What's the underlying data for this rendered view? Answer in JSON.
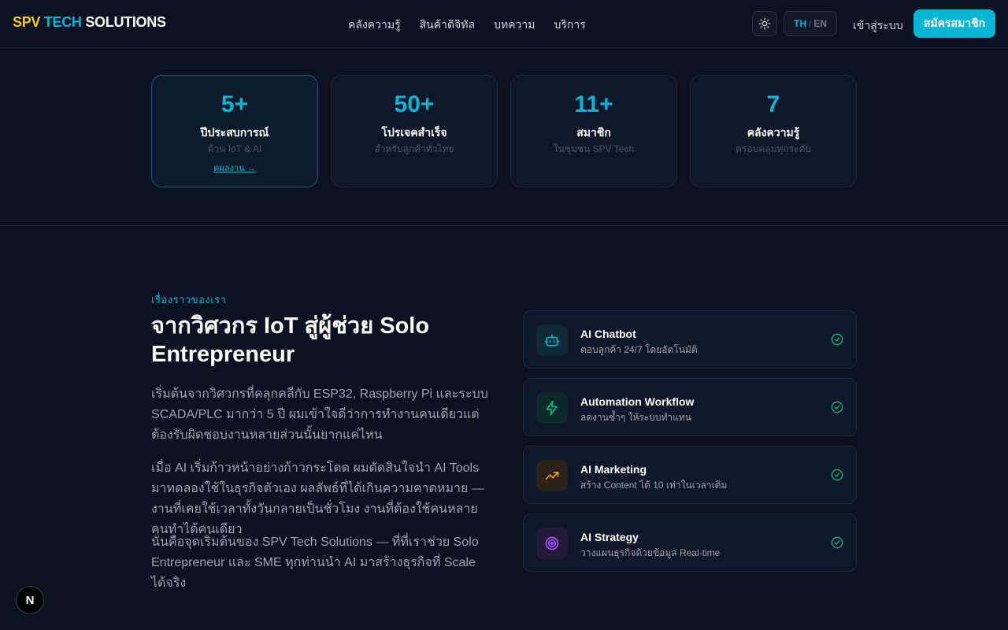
{
  "brand": {
    "part1": "SPV",
    "part2": "TECH",
    "part3": "SOLUTIONS"
  },
  "nav": [
    "คลังความรู้",
    "สินค้าดิจิทัล",
    "บทความ",
    "บริการ"
  ],
  "header": {
    "lang_th": "TH",
    "lang_sep": "/",
    "lang_en": "EN",
    "login": "เข้าสู่ระบบ",
    "signup": "สมัครสมาชิก",
    "theme_icon": "sun-icon"
  },
  "stats": [
    {
      "num": "5+",
      "label": "ปีประสบการณ์",
      "sub": "ด้าน IoT & AI",
      "link": "ดูผลงาน →"
    },
    {
      "num": "50+",
      "label": "โปรเจคสำเร็จ",
      "sub": "สำหรับลูกค้าทั่วไทย"
    },
    {
      "num": "11+",
      "label": "สมาชิก",
      "sub": "ในชุมชน SPV Tech"
    },
    {
      "num": "7",
      "label": "คลังความรู้",
      "sub": "ครอบคลุมทุกระดับ"
    }
  ],
  "story": {
    "eyebrow": "เรื่องราวของเรา",
    "title": "จากวิศวกร IoT สู่ผู้ช่วย Solo Entrepreneur",
    "p1": "เริ่มต้นจากวิศวกรที่คลุกคลีกับ ESP32, Raspberry Pi และระบบ SCADA/PLC มากว่า 5 ปี ผมเข้าใจดีว่าการทำงานคนเดียวแต่ต้องรับผิดชอบงานหลายส่วนนั้นยากแค่ไหน",
    "p2": "เมื่อ AI เริ่มก้าวหน้าอย่างก้าวกระโดด ผมตัดสินใจนำ AI Tools มาทดลองใช้ในธุรกิจตัวเอง ผลลัพธ์ที่ได้เกินความคาดหมาย — งานที่เคยใช้เวลาทั้งวันกลายเป็นชั่วโมง งานที่ต้องใช้คนหลายคนทำได้คนเดียว",
    "p3": "นั่นคือจุดเริ่มต้นของ SPV Tech Solutions — ที่ที่เราช่วย Solo Entrepreneur และ SME ทุกท่านนำ AI มาสร้างธุรกิจที่ Scale ได้จริง"
  },
  "features": [
    {
      "title": "AI Chatbot",
      "desc": "ตอบลูกค้า 24/7 โดยอัตโนมัติ",
      "icon": "robot-icon",
      "color": "#06b6d4",
      "bg": "#0e2a36"
    },
    {
      "title": "Automation Workflow",
      "desc": "ลดงานซ้ำๆ ให้ระบบทำแทน",
      "icon": "lightning-icon",
      "color": "#10b981",
      "bg": "#0c2a28"
    },
    {
      "title": "AI Marketing",
      "desc": "สร้าง Content ได้ 10 เท่าในเวลาเดิม",
      "icon": "trending-up-icon",
      "color": "#f59e0b",
      "bg": "#2a2219"
    },
    {
      "title": "AI Strategy",
      "desc": "วางแผนธุรกิจด้วยข้อมูล Real-time",
      "icon": "target-icon",
      "color": "#a855f7",
      "bg": "#231a3a"
    }
  ],
  "check_color": "#10b981",
  "badge": "N"
}
